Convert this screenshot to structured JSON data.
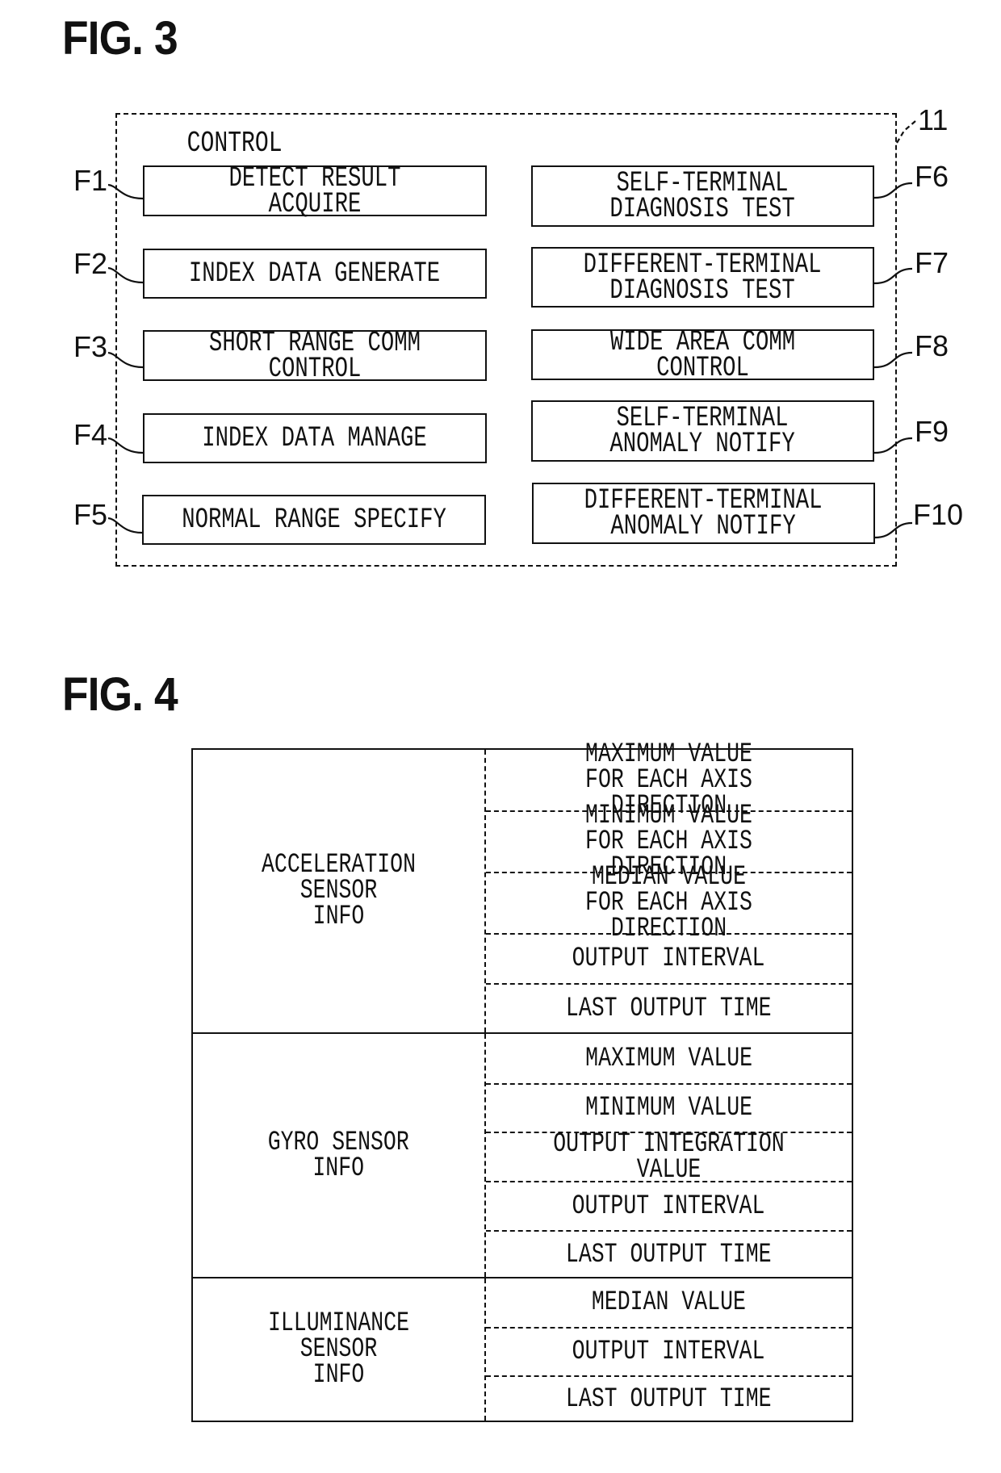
{
  "fig3": {
    "title": "FIG. 3",
    "reference_numeral": "11",
    "container_label": "CONTROL",
    "left_functions": [
      {
        "id": "F1",
        "label": "DETECT RESULT ACQUIRE"
      },
      {
        "id": "F2",
        "label": "INDEX DATA GENERATE"
      },
      {
        "id": "F3",
        "label": "SHORT RANGE COMM CONTROL"
      },
      {
        "id": "F4",
        "label": "INDEX DATA MANAGE"
      },
      {
        "id": "F5",
        "label": "NORMAL RANGE SPECIFY"
      }
    ],
    "right_functions": [
      {
        "id": "F6",
        "label": "SELF-TERMINAL\nDIAGNOSIS TEST"
      },
      {
        "id": "F7",
        "label": "DIFFERENT-TERMINAL\nDIAGNOSIS TEST"
      },
      {
        "id": "F8",
        "label": "WIDE AREA COMM CONTROL"
      },
      {
        "id": "F9",
        "label": "SELF-TERMINAL\nANOMALY NOTIFY"
      },
      {
        "id": "F10",
        "label": "DIFFERENT-TERMINAL\nANOMALY NOTIFY"
      }
    ]
  },
  "fig4": {
    "title": "FIG. 4",
    "groups": [
      {
        "label": "ACCELERATION SENSOR\nINFO",
        "items": [
          "MAXIMUM VALUE\nFOR EACH AXIS DIRECTION",
          "MINIMUM VALUE\nFOR EACH AXIS DIRECTION",
          "MEDIAN VALUE\nFOR EACH AXIS DIRECTION",
          "OUTPUT INTERVAL",
          "LAST OUTPUT TIME"
        ]
      },
      {
        "label": "GYRO SENSOR\nINFO",
        "items": [
          "MAXIMUM VALUE",
          "MINIMUM VALUE",
          "OUTPUT INTEGRATION VALUE",
          "OUTPUT INTERVAL",
          "LAST OUTPUT TIME"
        ]
      },
      {
        "label": "ILLUMINANCE SENSOR\nINFO",
        "items": [
          "MEDIAN VALUE",
          "OUTPUT INTERVAL",
          "LAST OUTPUT TIME"
        ]
      }
    ]
  }
}
